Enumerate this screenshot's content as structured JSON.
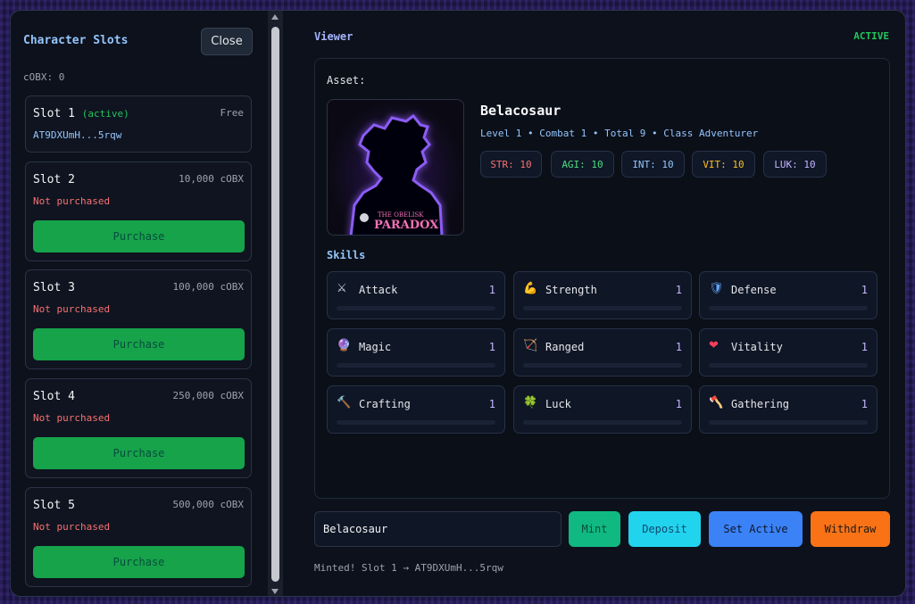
{
  "sidebar": {
    "title": "Character Slots",
    "close_label": "Close",
    "cobx_balance": "cOBX: 0",
    "slots": [
      {
        "name": "Slot 1",
        "tag": "(active)",
        "price": "Free",
        "address": "AT9DXUmH...5rqw",
        "status": "",
        "button": ""
      },
      {
        "name": "Slot 2",
        "tag": "",
        "price": "10,000 cOBX",
        "address": "",
        "status": "Not purchased",
        "button": "Purchase"
      },
      {
        "name": "Slot 3",
        "tag": "",
        "price": "100,000 cOBX",
        "address": "",
        "status": "Not purchased",
        "button": "Purchase"
      },
      {
        "name": "Slot 4",
        "tag": "",
        "price": "250,000 cOBX",
        "address": "",
        "status": "Not purchased",
        "button": "Purchase"
      },
      {
        "name": "Slot 5",
        "tag": "",
        "price": "500,000 cOBX",
        "address": "",
        "status": "Not purchased",
        "button": "Purchase"
      }
    ]
  },
  "viewer": {
    "title": "Viewer",
    "status": "ACTIVE",
    "asset_label": "Asset:",
    "avatar_logo_line1": "THE OBELISK",
    "avatar_logo_line2": "PARADOX",
    "character": {
      "name": "Belacosaur",
      "meta": "Level 1 • Combat 1 • Total 9 • Class Adventurer"
    },
    "stats": [
      {
        "label": "STR: 10",
        "color": "#f87171"
      },
      {
        "label": "AGI: 10",
        "color": "#4ade80"
      },
      {
        "label": "INT: 10",
        "color": "#93c5fd"
      },
      {
        "label": "VIT: 10",
        "color": "#fbbf24"
      },
      {
        "label": "LUK: 10",
        "color": "#c4b5fd"
      }
    ],
    "skills_title": "Skills",
    "skills": [
      {
        "icon": "⚔",
        "name": "Attack",
        "value": "1",
        "icon_name": "crossed-swords-icon"
      },
      {
        "icon": "💪",
        "name": "Strength",
        "value": "1",
        "icon_name": "flexed-arm-icon"
      },
      {
        "icon": "🛡",
        "name": "Defense",
        "value": "1",
        "icon_name": "shield-icon"
      },
      {
        "icon": "🔮",
        "name": "Magic",
        "value": "1",
        "icon_name": "crystal-ball-icon"
      },
      {
        "icon": "🏹",
        "name": "Ranged",
        "value": "1",
        "icon_name": "bow-arrow-icon"
      },
      {
        "icon": "❤",
        "name": "Vitality",
        "value": "1",
        "icon_name": "heart-icon"
      },
      {
        "icon": "🔨",
        "name": "Crafting",
        "value": "1",
        "icon_name": "hammer-icon"
      },
      {
        "icon": "🍀",
        "name": "Luck",
        "value": "1",
        "icon_name": "clover-icon"
      },
      {
        "icon": "🪓",
        "name": "Gathering",
        "value": "1",
        "icon_name": "axe-icon"
      }
    ]
  },
  "actions": {
    "name_value": "Belacosaur",
    "mint": "Mint",
    "deposit": "Deposit",
    "set_active": "Set Active",
    "withdraw": "Withdraw"
  },
  "footer": {
    "message": "Minted! Slot 1 → AT9DXUmH...5rqw"
  }
}
